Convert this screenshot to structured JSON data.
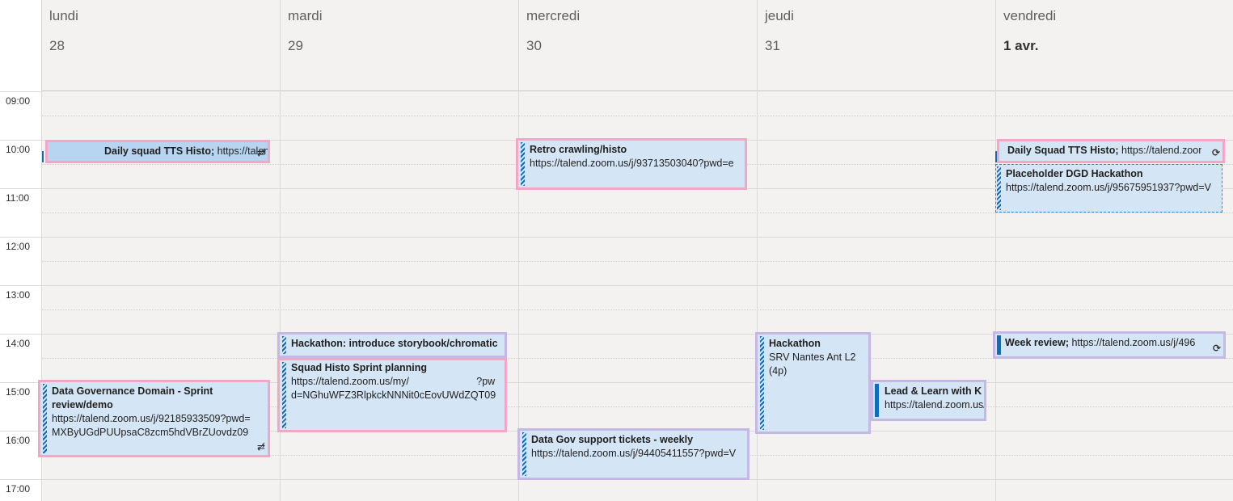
{
  "days": [
    {
      "name": "lundi",
      "date": "28"
    },
    {
      "name": "mardi",
      "date": "29"
    },
    {
      "name": "mercredi",
      "date": "30"
    },
    {
      "name": "jeudi",
      "date": "31"
    },
    {
      "name": "vendredi",
      "date": "1 avr."
    }
  ],
  "hours": [
    "09:00",
    "10:00",
    "11:00",
    "12:00",
    "13:00",
    "14:00",
    "15:00",
    "16:00",
    "17:00"
  ],
  "events": {
    "mon_daily": {
      "title": "Daily squad TTS Histo;",
      "rest": " https://talend.zoom.us/j/",
      "icon": "not-synced-icon"
    },
    "mon_dgd": {
      "title": "Data Governance Domain - Sprint review/demo",
      "line1": "https://talend.zoom.us/j/92185933509?pwd=",
      "line2": "MXByUGdPUUpsaC8zcm5hdVBrZUovdz09",
      "icon": "not-synced-icon"
    },
    "tue_hack": {
      "title": "Hackathon: introduce storybook/chromatic"
    },
    "tue_squad": {
      "title": "Squad Histo Sprint planning",
      "line1": "https://talend.zoom.us/my/                        ?pw",
      "line2": "d=NGhuWFZ3RlpkckNNNit0cEovUWdZQT09"
    },
    "wed_retro": {
      "title": "Retro crawling/histo",
      "line1": "https://talend.zoom.us/j/93713503040?pwd=e"
    },
    "wed_datagov": {
      "title": "Data Gov support tickets - weekly",
      "line1": "https://talend.zoom.us/j/94405411557?pwd=V"
    },
    "thu_hack": {
      "title": "Hackathon",
      "line1": "SRV Nantes Ant L2",
      "line2": "(4p)"
    },
    "thu_lead": {
      "title": "Lead & Learn with K",
      "line1": "https://talend.zoom.us/j/"
    },
    "fri_daily": {
      "title": "Daily Squad TTS Histo;",
      "rest": " https://talend.zoom.us/j/",
      "icon": "sync-icon"
    },
    "fri_placeholder": {
      "title": "Placeholder DGD Hackathon",
      "line1": "https://talend.zoom.us/j/95675951937?pwd=V"
    },
    "fri_week": {
      "title": "Week review;",
      "rest": " https://talend.zoom.us/j/496",
      "icon": "sync-icon"
    }
  },
  "colors": {
    "event_fill": "#d4e5f6",
    "organizer_border": "#f4a7c5",
    "attendee_border": "#c5b8e4",
    "accent": "#0f6cbd"
  }
}
